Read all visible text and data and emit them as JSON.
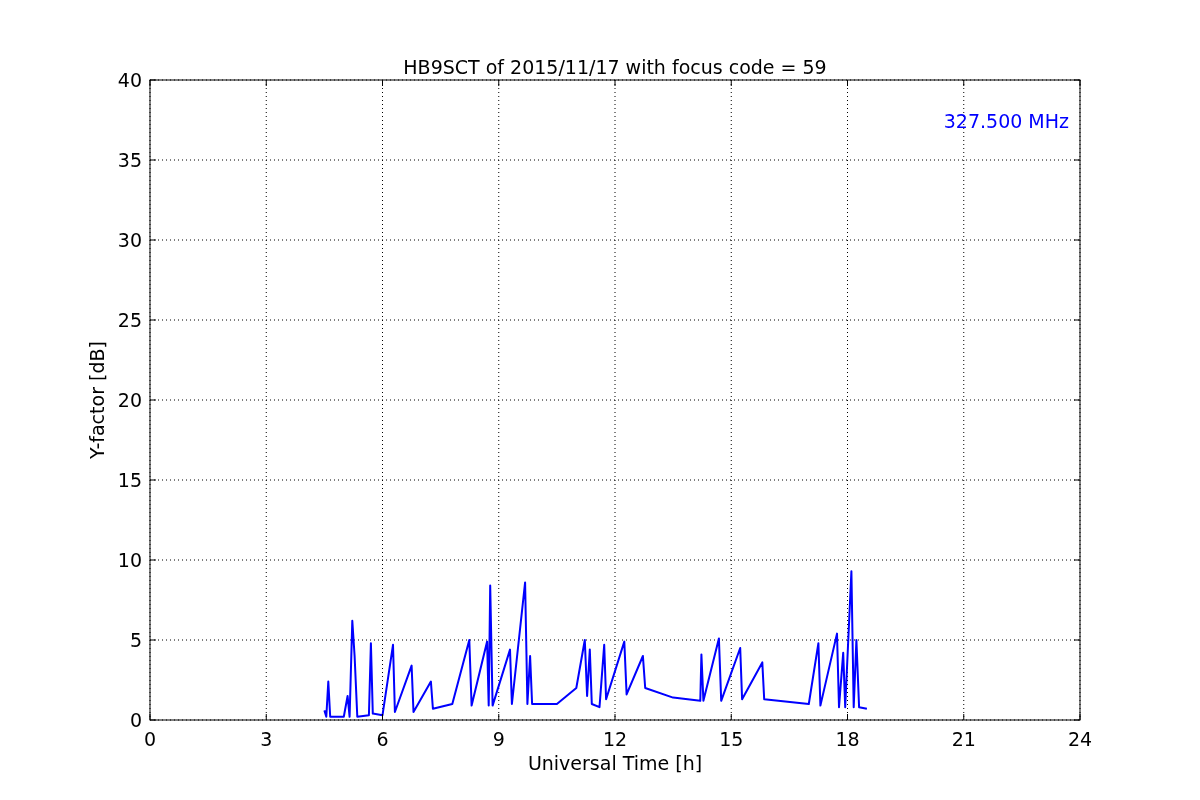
{
  "figure": {
    "chart_data": {
      "type": "line",
      "title": "HB9SCT of 2015/11/17 with focus code = 59",
      "xlabel": "Universal Time [h]",
      "ylabel": "Y-factor [dB]",
      "xlim": [
        0,
        24
      ],
      "ylim": [
        0,
        40
      ],
      "xticks": [
        0,
        3,
        6,
        9,
        12,
        15,
        18,
        21,
        24
      ],
      "yticks": [
        0,
        5,
        10,
        15,
        20,
        25,
        30,
        35,
        40
      ],
      "x": [
        4.5,
        4.55,
        4.6,
        4.65,
        5.0,
        5.1,
        5.15,
        5.22,
        5.28,
        5.35,
        5.65,
        5.7,
        5.75,
        6.0,
        6.27,
        6.32,
        6.75,
        6.8,
        7.25,
        7.3,
        7.8,
        8.24,
        8.3,
        8.7,
        8.74,
        8.78,
        8.84,
        9.29,
        9.34,
        9.68,
        9.74,
        9.81,
        9.86,
        10.5,
        11.0,
        11.22,
        11.28,
        11.35,
        11.4,
        11.6,
        11.72,
        11.77,
        12.24,
        12.3,
        12.72,
        12.78,
        13.5,
        14.2,
        14.23,
        14.28,
        14.68,
        14.74,
        15.23,
        15.28,
        15.8,
        15.85,
        17.0,
        17.25,
        17.3,
        17.73,
        17.78,
        17.89,
        17.94,
        18.1,
        18.16,
        18.23,
        18.3,
        18.5
      ],
      "series": [
        {
          "color": "#0000ff",
          "values": [
            0.6,
            0.2,
            2.4,
            0.2,
            0.2,
            1.5,
            0.2,
            6.2,
            4.0,
            0.2,
            0.3,
            4.8,
            0.4,
            0.3,
            4.7,
            0.5,
            3.4,
            0.5,
            2.4,
            0.7,
            1.0,
            5.0,
            0.9,
            4.9,
            0.9,
            8.4,
            0.9,
            4.4,
            1.0,
            8.6,
            1.0,
            4.0,
            1.0,
            1.0,
            2.0,
            5.0,
            1.5,
            4.4,
            1.0,
            0.8,
            4.7,
            1.3,
            4.9,
            1.6,
            4.0,
            2.0,
            1.4,
            1.2,
            4.1,
            1.2,
            5.1,
            1.2,
            4.5,
            1.3,
            3.6,
            1.3,
            1.0,
            4.8,
            0.9,
            5.4,
            0.8,
            4.2,
            0.8,
            9.3,
            0.8,
            5.0,
            0.8,
            0.7
          ]
        }
      ],
      "grid": true,
      "annotations": [
        {
          "text": "327.500 MHz"
        }
      ]
    }
  }
}
